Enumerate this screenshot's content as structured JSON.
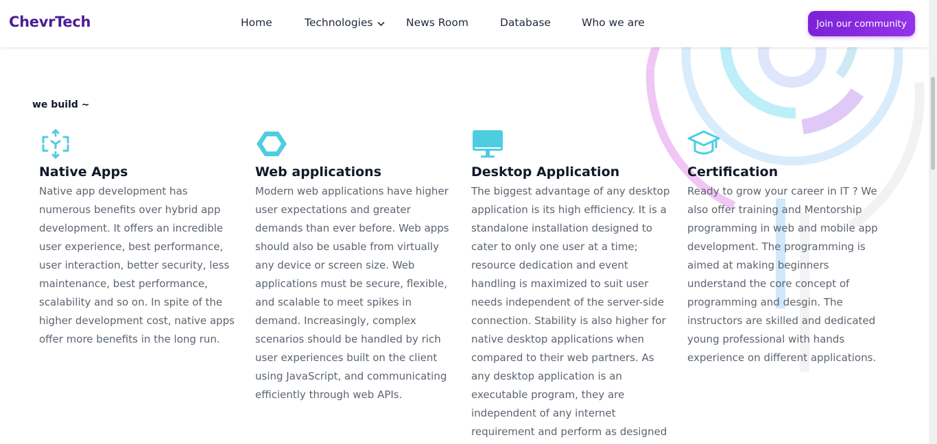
{
  "brand": {
    "name": "ChevrTech",
    "accent": "#7c22d6",
    "icon_color": "#4fcde0"
  },
  "nav": {
    "items": [
      {
        "label": "Home"
      },
      {
        "label": "Technologies",
        "has_dropdown": true
      },
      {
        "label": "News Room"
      },
      {
        "label": "Database"
      },
      {
        "label": "Who we are"
      }
    ]
  },
  "cta": {
    "label": "Join our community"
  },
  "section": {
    "intro": "we build ~",
    "cards": [
      {
        "icon": "cube-arrows-icon",
        "title": "Native Apps",
        "text": "Native app development has numerous benefits over hybrid app development. It offers an incredible user experience, best performance, user interaction, better security, less maintenance, best performance, scalability and so on. In spite of the higher development cost, native apps offer more benefits in the long run."
      },
      {
        "icon": "hexagon-icon",
        "title": "Web applications",
        "text": "Modern web applications have higher user expectations and greater demands than ever before. Web apps should also be usable from virtually any device or screen size. Web applications must be secure, flexible, and scalable to meet spikes in demand. Increasingly, complex scenarios should be handled by rich user experiences built on the client using JavaScript, and communicating efficiently through web APIs."
      },
      {
        "icon": "monitor-icon",
        "title": "Desktop Application",
        "text": "The biggest advantage of any desktop application is its high efficiency. It is a standalone installation designed to cater to only one user at a time; resource dedication and event handling is maximized to suit user needs independent of the server-side connection. Stability is also higher for native desktop applications when compared to their web partners. As any desktop application is an executable program, they are independent of any internet requirement and perform as designed"
      },
      {
        "icon": "graduation-cap-icon",
        "title": "Certification",
        "text": "Ready to grow your career in IT ? We also offer training and Mentorship programming in web and mobile app development. The programming is aimed at making beginners understand the core concept of programming and desgin. The instructors are skilled and dedicated young professional with hands experience on different applications."
      }
    ]
  }
}
